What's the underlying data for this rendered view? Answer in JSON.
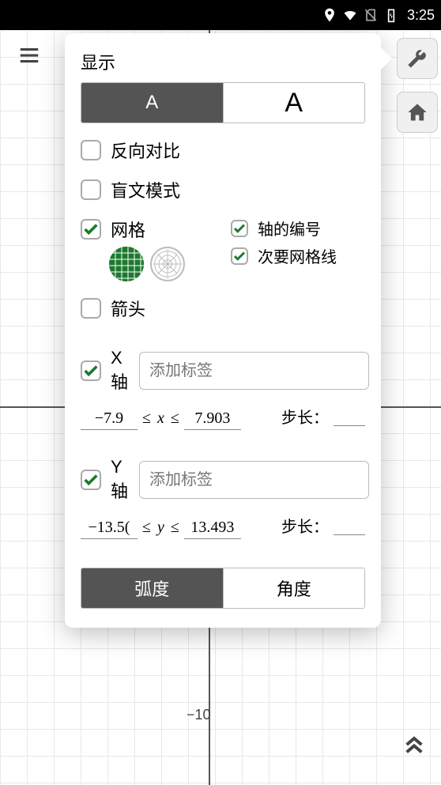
{
  "statusbar": {
    "time": "3:25"
  },
  "graph": {
    "axis_tick_minus10": "−10"
  },
  "panel": {
    "title": "显示",
    "font_small": "A",
    "font_large": "A",
    "reverse_contrast": "反向对比",
    "braille_mode": "盲文模式",
    "grid": "网格",
    "axis_numbers": "轴的编号",
    "minor_gridlines": "次要网格线",
    "arrows": "箭头",
    "x_axis": "X轴",
    "y_axis": "Y轴",
    "label_placeholder": "添加标签",
    "le_symbol": "≤",
    "x_var": "x",
    "y_var": "y",
    "x_min": "−7.9",
    "x_max": "7.903",
    "y_min": "−13.5(",
    "y_max": "13.493",
    "step_label": "步长：",
    "radians": "弧度",
    "degrees": "角度"
  }
}
